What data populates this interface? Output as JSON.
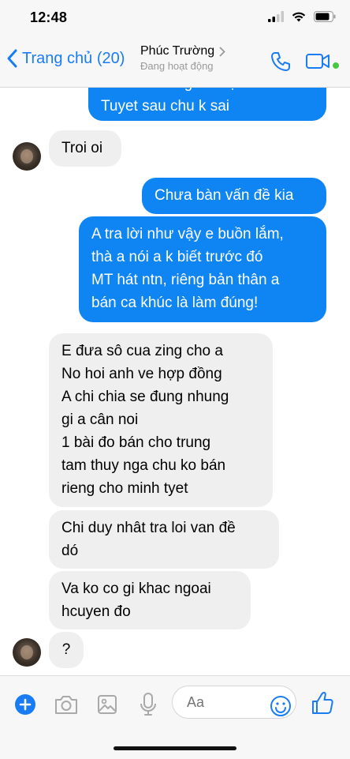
{
  "status_bar": {
    "time": "12:48"
  },
  "header": {
    "back_label": "Trang chủ (20)",
    "contact_name": "Phúc Trường",
    "contact_status": "Đang hoạt động"
  },
  "messages": [
    {
      "sender": "me",
      "lines": [
        "Tuyet sau chu k sai"
      ],
      "partial_top_line": "nữa.. Ko rung ve luật la e"
    },
    {
      "sender": "them",
      "lines": [
        "Troi oi"
      ]
    },
    {
      "sender": "me",
      "lines": [
        "Chưa bàn vấn đề kia"
      ]
    },
    {
      "sender": "me",
      "lines": [
        "A tra lời như vậy e buồn lắm,",
        "thà a nói a k biết trước đó",
        "MT hát ntn, riêng bản thân a",
        "bán ca khúc là làm đúng!"
      ]
    },
    {
      "sender": "them",
      "lines": [
        "E đưa sô cua zing cho a",
        "No hoi anh ve hợp đồng",
        "A chi chia se đung nhung",
        "gi a cân noi",
        "1 bài đo bán cho trung",
        "tam thuy nga chu ko bán",
        "rieng cho minh tyet"
      ]
    },
    {
      "sender": "them",
      "lines": [
        "Chi duy nhât tra loi van đề",
        "dó"
      ]
    },
    {
      "sender": "them",
      "lines": [
        "Va ko co gi khac ngoai",
        "hcuyen đo"
      ]
    },
    {
      "sender": "them",
      "lines": [
        "?"
      ]
    }
  ],
  "composer": {
    "placeholder": "Aa"
  },
  "colors": {
    "accent": "#1a7cf5",
    "my_bubble": "#0f84f3",
    "their_bubble": "#efefef",
    "online_dot": "#44c940"
  }
}
